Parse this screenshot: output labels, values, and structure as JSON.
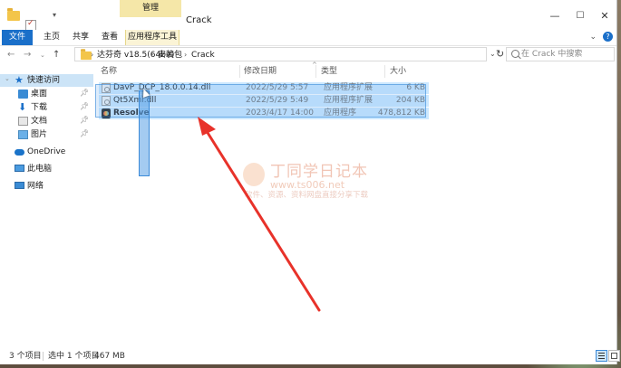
{
  "window": {
    "title": "Crack",
    "context_tab_group": "管理",
    "quick_access_icons": [
      "folder-icon",
      "properties-icon",
      "new-folder-icon"
    ]
  },
  "ribbon": {
    "tabs": [
      "文件",
      "主页",
      "共享",
      "查看",
      "应用程序工具"
    ],
    "active_tab": "文件"
  },
  "address": {
    "breadcrumbs": [
      "达芬奇 v18.5(64bit)",
      "安装包",
      "Crack"
    ],
    "search_placeholder": "在 Crack 中搜索"
  },
  "nav": {
    "items": [
      {
        "label": "快速访问",
        "icon": "star-icon",
        "selected": true
      },
      {
        "label": "桌面",
        "icon": "desktop-icon",
        "pinned": true
      },
      {
        "label": "下载",
        "icon": "download-icon",
        "pinned": true
      },
      {
        "label": "文档",
        "icon": "document-icon",
        "pinned": true
      },
      {
        "label": "图片",
        "icon": "picture-icon",
        "pinned": true
      },
      {
        "label": "OneDrive",
        "icon": "onedrive-icon"
      },
      {
        "label": "此电脑",
        "icon": "pc-icon"
      },
      {
        "label": "网络",
        "icon": "network-icon"
      }
    ]
  },
  "columns": {
    "name": "名称",
    "date": "修改日期",
    "type": "类型",
    "size": "大小"
  },
  "files": [
    {
      "name": "DavP_DCP_18.0.0.14.dll",
      "date": "2022/5/29 5:57",
      "type": "应用程序扩展",
      "size": "6 KB",
      "icon": "dll-file-icon"
    },
    {
      "name": "Qt5Xml.dll",
      "date": "2022/5/29 5:49",
      "type": "应用程序扩展",
      "size": "204 KB",
      "icon": "dll-file-icon"
    },
    {
      "name": "Resolve",
      "date": "2023/4/17 14:00",
      "type": "应用程序",
      "size": "478,812 KB",
      "icon": "resolve-app-icon"
    }
  ],
  "watermark": {
    "title": "丁同学日记本",
    "url": "www.ts006.net",
    "tagline": "软件、资源、资料网盘直接分享下载"
  },
  "status": {
    "item_count": "3 个项目",
    "selected": "选中 1 个项目",
    "selected_size": "467 MB"
  },
  "colors": {
    "accent": "#1a6fc9",
    "selection": "#cce8ff",
    "arrow": "#e8322a"
  }
}
